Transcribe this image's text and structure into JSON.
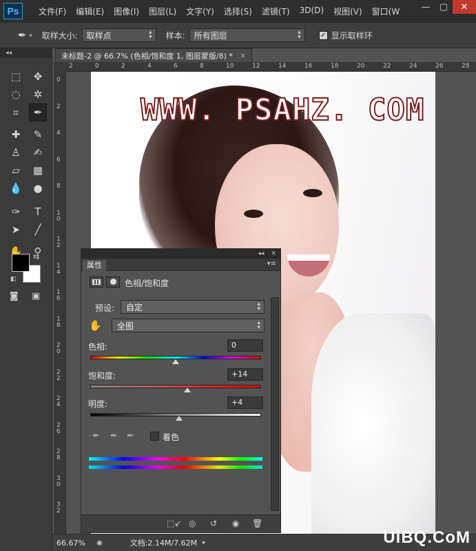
{
  "app": {
    "logo": "Ps"
  },
  "menu": [
    "文件(F)",
    "编辑(E)",
    "图像(I)",
    "图层(L)",
    "文字(Y)",
    "选择(S)",
    "滤镜(T)",
    "3D(D)",
    "视图(V)",
    "窗口(W"
  ],
  "window_controls": {
    "minimize": "—",
    "maximize": "▢",
    "close": "✕"
  },
  "options": {
    "sample_size_label": "取样大小:",
    "sample_size_value": "取样点",
    "sample_label": "样本:",
    "sample_value": "所有图层",
    "show_ring_label": "显示取样环",
    "show_ring_checked": true
  },
  "document": {
    "tab_title": "未标题-2 @ 66.7% (色相/饱和度 1, 图层蒙版/8) *",
    "ruler_top": [
      "2",
      "0",
      "2",
      "4",
      "6",
      "8",
      "10",
      "12",
      "14",
      "16",
      "18",
      "20",
      "22",
      "24",
      "26",
      "28"
    ],
    "ruler_left": [
      "0",
      "2",
      "4",
      "6",
      "8",
      "1 0",
      "1 2",
      "1 4",
      "1 6",
      "1 8",
      "2 0",
      "2 2",
      "2 4",
      "2 6",
      "2 8",
      "3 0",
      "3 2"
    ],
    "watermark": "WWW. PSAHZ. COM"
  },
  "properties": {
    "tab": "属性",
    "adjustment_title": "色相/饱和度",
    "preset_label": "预设:",
    "preset_value": "自定",
    "channel_value": "全图",
    "hue": {
      "label": "色相:",
      "value": "0",
      "position": 0.5
    },
    "saturation": {
      "label": "饱和度:",
      "value": "+14",
      "position": 0.57
    },
    "lightness": {
      "label": "明度:",
      "value": "+4",
      "position": 0.52
    },
    "colorize_label": "着色",
    "colorize_checked": false
  },
  "status": {
    "zoom": "66.67%",
    "doc_size": "文档:2.14M/7.62M"
  },
  "site_logo": "UiBQ.CoM",
  "colors": {
    "menu_bg": "#2e2e2e",
    "panel_bg": "#535353",
    "close_red": "#c0392b",
    "accent_blue": "#2c9ed8"
  }
}
